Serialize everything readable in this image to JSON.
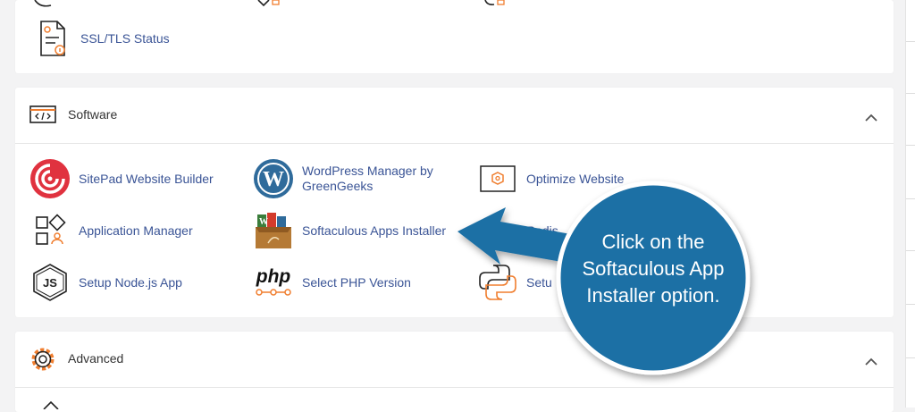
{
  "security": {
    "items": [
      {
        "label": "SSL/TLS Status",
        "icon": "certificate-icon"
      }
    ]
  },
  "software": {
    "title": "Software",
    "icon": "code-window-icon",
    "items": [
      {
        "label": "SitePad Website Builder",
        "icon": "sitepad-icon"
      },
      {
        "label": "WordPress Manager by GreenGeeks",
        "icon": "wordpress-icon"
      },
      {
        "label": "Optimize Website",
        "icon": "optimize-icon"
      },
      {
        "label": "Application Manager",
        "icon": "app-manager-icon"
      },
      {
        "label": "Softaculous Apps Installer",
        "icon": "softaculous-icon"
      },
      {
        "label": "Redis",
        "icon": "redis-icon"
      },
      {
        "label": "Setup Node.js App",
        "icon": "nodejs-icon"
      },
      {
        "label": "Select PHP Version",
        "icon": "php-icon"
      },
      {
        "label": "Setu",
        "icon": "python-icon"
      }
    ]
  },
  "advanced": {
    "title": "Advanced",
    "icon": "gear-icon"
  },
  "callout": {
    "text": "Click on the Softaculous App Installer option.",
    "color": "#1c6fa5"
  },
  "colors": {
    "link": "#3a5496",
    "accent": "#f07e2f",
    "background": "#f3f3f4"
  }
}
